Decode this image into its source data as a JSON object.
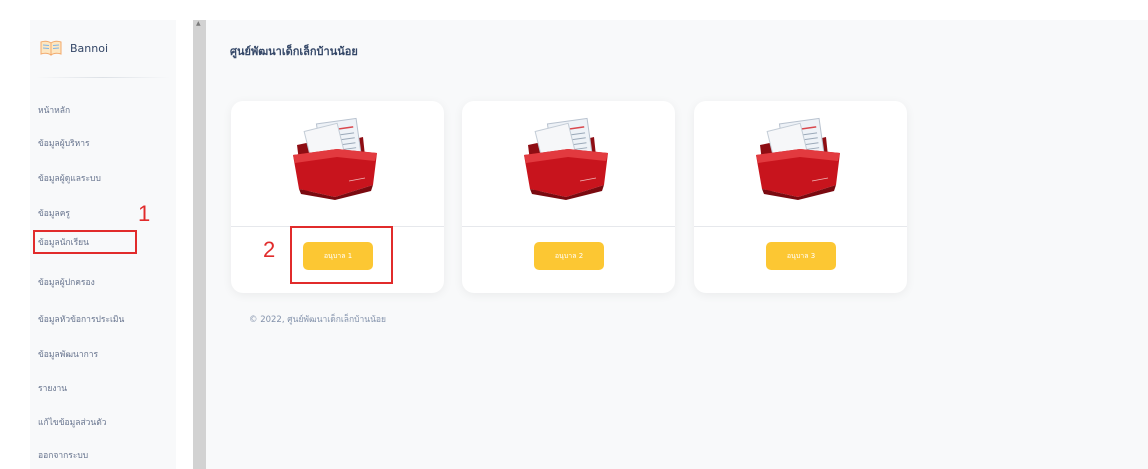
{
  "brand": {
    "name": "Bannoi",
    "icon": "open-book-icon"
  },
  "sidebar": {
    "items": [
      {
        "label": "หน้าหลัก"
      },
      {
        "label": "ข้อมูลผู้บริหาร"
      },
      {
        "label": "ข้อมูลผู้ดูแลระบบ"
      },
      {
        "label": "ข้อมูลครู"
      },
      {
        "label": "ข้อมูลนักเรียน"
      },
      {
        "label": "ข้อมูลผู้ปกครอง"
      },
      {
        "label": "ข้อมูลหัวข้อการประเมิน"
      },
      {
        "label": "ข้อมูลพัฒนาการ"
      },
      {
        "label": "รายงาน"
      },
      {
        "label": "แก้ไขข้อมูลส่วนตัว"
      },
      {
        "label": "ออกจากระบบ"
      }
    ]
  },
  "main": {
    "title": "ศูนย์พัฒนาเด็กเล็กบ้านน้อย",
    "cards": [
      {
        "button_label": "อนุบาล 1",
        "icon": "red-folder-icon"
      },
      {
        "button_label": "อนุบาล 2",
        "icon": "red-folder-icon"
      },
      {
        "button_label": "อนุบาล 3",
        "icon": "red-folder-icon"
      }
    ],
    "footer": "© 2022, ศูนย์พัฒนาเด็กเล็กบ้านน้อย"
  },
  "annotations": {
    "step1": "1",
    "step2": "2"
  },
  "colors": {
    "accent_yellow": "#fcc733",
    "highlight_red": "#e12b2b",
    "folder_red": "#c8141d",
    "background": "#f8f9fa"
  }
}
